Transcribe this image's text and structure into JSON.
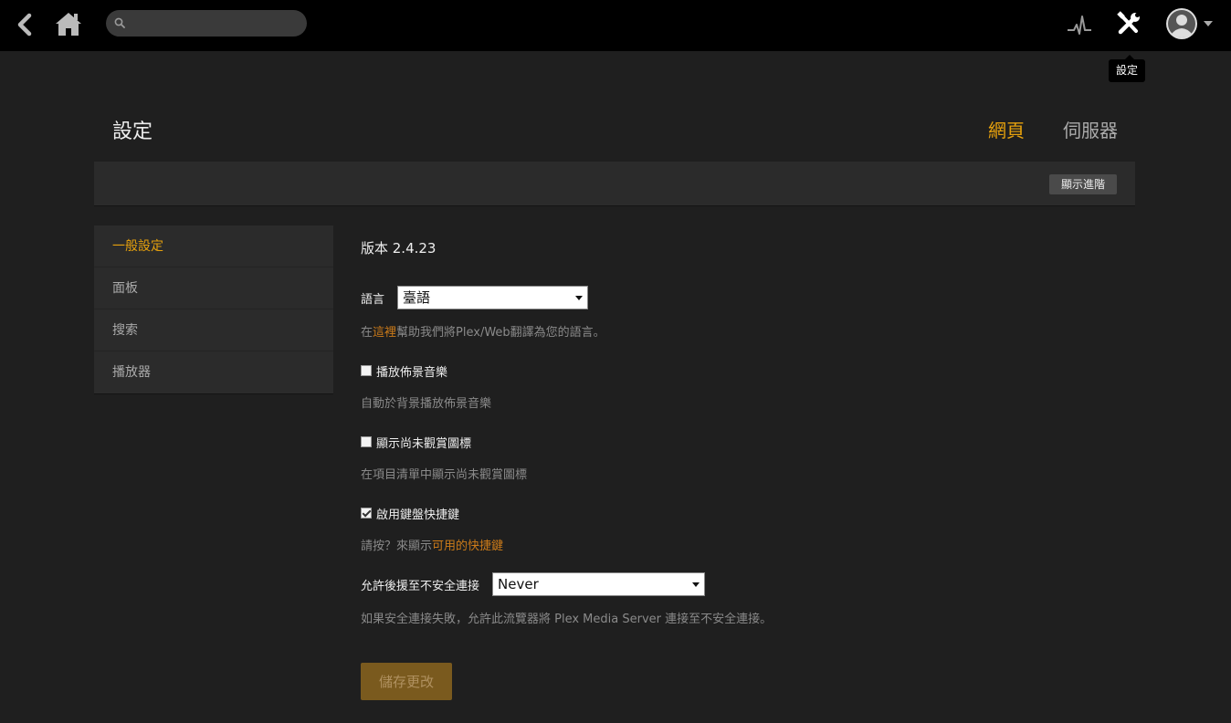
{
  "topbar": {
    "back_icon": "chevron-left-icon",
    "home_icon": "home-icon",
    "search": {
      "placeholder": "",
      "value": "",
      "icon": "search-icon"
    },
    "activity_icon": "activity-pulse-icon",
    "settings_icon": "tools-icon",
    "user_icon": "user-avatar-icon",
    "tooltip": "設定"
  },
  "header": {
    "title": "設定",
    "tabs": [
      {
        "label": "網頁",
        "active": true
      },
      {
        "label": "伺服器",
        "active": false
      }
    ],
    "advanced_button": "顯示進階"
  },
  "sidebar": {
    "items": [
      {
        "label": "一般設定",
        "active": true
      },
      {
        "label": "面板",
        "active": false
      },
      {
        "label": "搜索",
        "active": false
      },
      {
        "label": "播放器",
        "active": false
      }
    ]
  },
  "settings": {
    "version": "版本 2.4.23",
    "language": {
      "label": "語言",
      "value": "臺語",
      "help_prefix": "在",
      "help_link": "這裡",
      "help_suffix": "幫助我們將Plex/Web翻譯為您的語言。"
    },
    "theme_music": {
      "label": "播放佈景音樂",
      "checked": false,
      "help": "自動於背景播放佈景音樂"
    },
    "unwatched_icons": {
      "label": "顯示尚未觀賞圖標",
      "checked": false,
      "help": "在項目清單中顯示尚未觀賞圖標"
    },
    "keyboard_shortcuts": {
      "label": "啟用鍵盤快捷鍵",
      "checked": true,
      "help_prefix": "請按？來顯示",
      "help_link": "可用的快捷鍵"
    },
    "insecure_fallback": {
      "label": "允許後援至不安全連接",
      "value": "Never",
      "help": "如果安全連接失敗，允許此流覽器將 Plex Media Server 連接至不安全連接。"
    },
    "save_button": "儲存更改"
  },
  "colors": {
    "accent": "#e5a00d",
    "link": "#cc7b19",
    "background": "#1f1f1f",
    "panel": "#2b2b2b",
    "topbar": "#000000"
  }
}
